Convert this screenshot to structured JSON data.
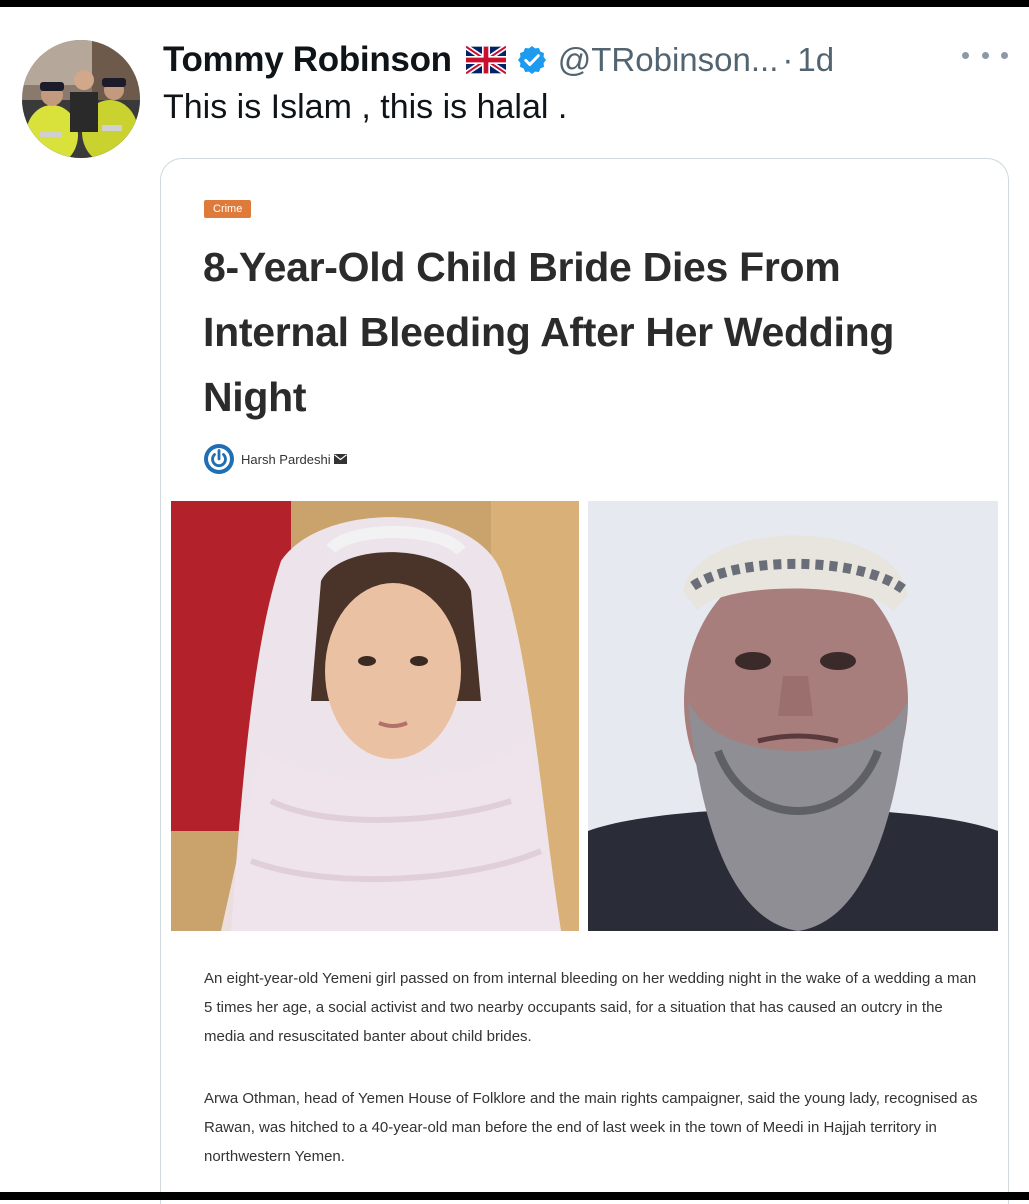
{
  "tweet": {
    "display_name": "Tommy Robinson",
    "handle": "@TRobinson...",
    "separator": "·",
    "time": "1d",
    "text": "This is Islam , this is halal ."
  },
  "icons": {
    "flag": "uk-flag-icon",
    "verified": "verified-badge-icon",
    "more": "more-options-icon",
    "author": "power-logo-icon",
    "mail": "mail-icon"
  },
  "colors": {
    "verified_blue": "#1d9bf0",
    "category_orange": "#de7b3a",
    "secondary_text": "#536471"
  },
  "article": {
    "category": "Crime",
    "title": "8-Year-Old Child Bride Dies From Internal Bleeding After Her Wedding Night",
    "author": "Harsh Pardeshi",
    "paragraph1": "An eight-year-old Yemeni girl passed on from internal bleeding on her wedding night in the wake of a wedding a man 5 times her age, a social activist and two nearby occupants said, for a situation that has caused an outcry in the media and resuscitated banter about child brides.",
    "paragraph2": "Arwa Othman, head of Yemen House of Folklore and the main rights campaigner, said the young lady, recognised as Rawan, was hitched to a 40-year-old man before the end of last week in the town of Meedi in Hajjah territory in northwestern Yemen."
  }
}
